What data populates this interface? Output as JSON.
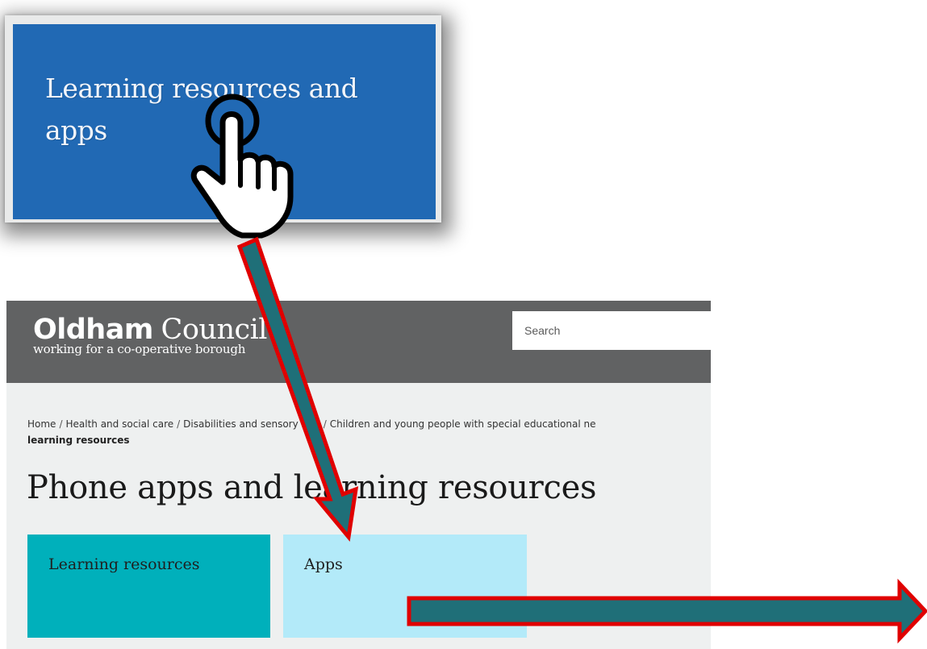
{
  "zoom_callout": {
    "tile_text": "Learning resources and apps"
  },
  "header": {
    "logo_bold": "Oldham",
    "logo_light": "Council",
    "tagline": "working for a co-operative borough",
    "search_placeholder": "Search"
  },
  "breadcrumb": {
    "items": [
      "Home",
      "Health and social care",
      "Disabilities and sensory loss",
      "Children and young people with special educational ne"
    ],
    "current": "learning resources"
  },
  "page": {
    "title": "Phone apps and learning resources"
  },
  "tiles": [
    {
      "label": "Learning resources"
    },
    {
      "label": "Apps"
    }
  ],
  "colors": {
    "zoom_tile": "#2169b4",
    "header_bg": "#616263",
    "tile_learning": "#00b0bb",
    "tile_apps": "#b3eaf9",
    "arrow_fill": "#1f6f78",
    "arrow_outline": "#e00000"
  },
  "icons": {
    "cursor": "pointing-hand-icon",
    "arrows": [
      "arrow-down-icon",
      "arrow-right-icon"
    ]
  }
}
